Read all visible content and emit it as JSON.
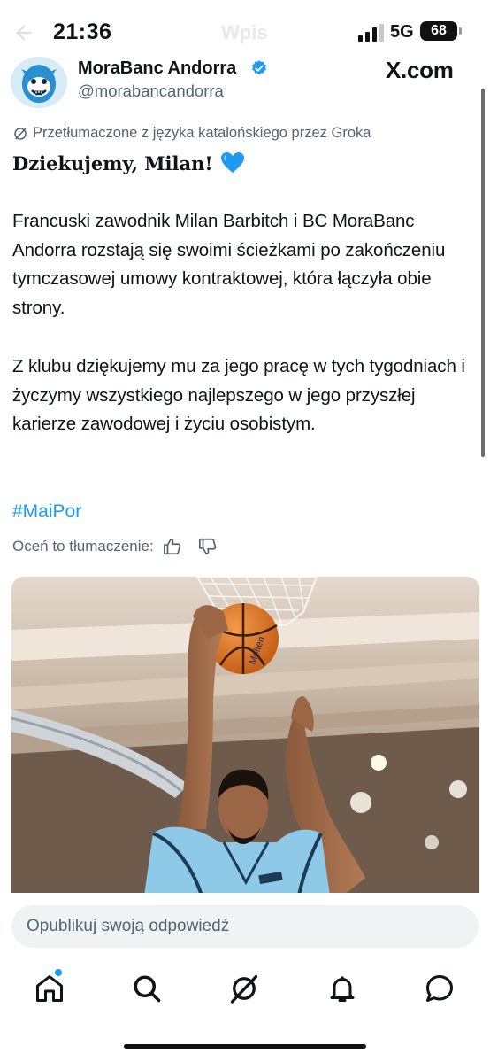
{
  "status_bar": {
    "time": "21:36",
    "network": "5G",
    "battery": "68",
    "ghost_title": "Wpis"
  },
  "header": {
    "account_name": "MoraBanc Andorra",
    "account_handle": "@morabancandorra",
    "watermark": "X.com"
  },
  "post": {
    "translated_note": "Przetłumaczone z języka katalońskiego przez Groka",
    "title": "Dziekujemy, Milan!",
    "paragraph1": "Francuski zawodnik Milan Barbitch i BC MoraBanc Andorra rozstają się swoimi ścieżkami po zakończeniu tymczasowej umowy kontraktowej, która łączyła obie strony.",
    "paragraph2": "Z klubu dziękujemy mu za jego pracę w tych tygodniach i życzymy wszystkiego najlepszego w jego przyszłej karierze zawodowej i życiu osobistym.",
    "hashtag": "#MaiPor",
    "rate_label": "Oceń to tłumaczenie:"
  },
  "photo": {
    "ball_text": "Molten"
  },
  "reply": {
    "placeholder": "Opublikuj swoją odpowiedź"
  },
  "colors": {
    "accent": "#1d9bf0",
    "muted": "#536471",
    "heart": "#1d9bf0"
  },
  "icons": [
    "back-arrow-icon",
    "signal-icon",
    "battery-icon",
    "verified-icon",
    "grok-icon",
    "blue-heart-icon",
    "thumbs-up-icon",
    "thumbs-down-icon",
    "home-icon",
    "search-icon",
    "grok-tab-icon",
    "notifications-icon",
    "messages-icon"
  ]
}
